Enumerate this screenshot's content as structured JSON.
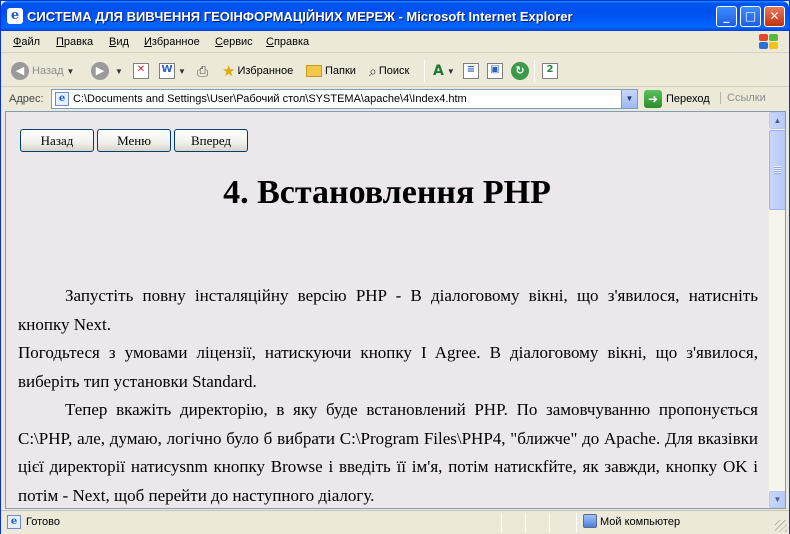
{
  "window": {
    "title": "СИСТЕМА ДЛЯ ВИВЧЕННЯ ГЕОІНФОРМАЦІЙНИХ МЕРЕЖ - Microsoft Internet Explorer"
  },
  "menubar": {
    "items": [
      "Файл",
      "Правка",
      "Вид",
      "Избранное",
      "Сервис",
      "Справка"
    ]
  },
  "toolbar": {
    "back_label": "Назад",
    "favorites_label": "Избранное",
    "folders_label": "Папки",
    "search_label": "Поиск"
  },
  "address": {
    "label": "Адрес:",
    "url": "C:\\Documents and Settings\\User\\Рабочий стол\\SYSTEMA\\apache\\4\\Index4.htm",
    "go_label": "Переход",
    "links_label": "Ссылки"
  },
  "page": {
    "nav": {
      "back": "Назад",
      "menu": "Меню",
      "forward": "Вперед"
    },
    "heading": "4. Встановлення PHP",
    "paragraphs": [
      "Запустіть повну інсталяційну версію PHP - В діалоговому вікні, що з'явилося, натисніть кнопку Next.",
      "Погодьтеся з умовами ліцензії, натискуючи кнопку I Agree. В діалоговому вікні, що з'явилося, виберіть тип установки Standard.",
      "Тепер вкажіть директорію, в яку буде встановлений PHP. По замовчуванню пропонується C:\\PHP, але, думаю, логічно було б вибрати C:\\Program Files\\PHP4, \"ближче\" до Apache. Для вказівки цієї директорії натисуsnm кнопку Browse і введіть її ім'я, потім натискfйте, як завжди, кнопку OK і потім - Next, щоб перейти до наступного діалогу."
    ]
  },
  "statusbar": {
    "status": "Готово",
    "zone": "Мой компьютер"
  }
}
